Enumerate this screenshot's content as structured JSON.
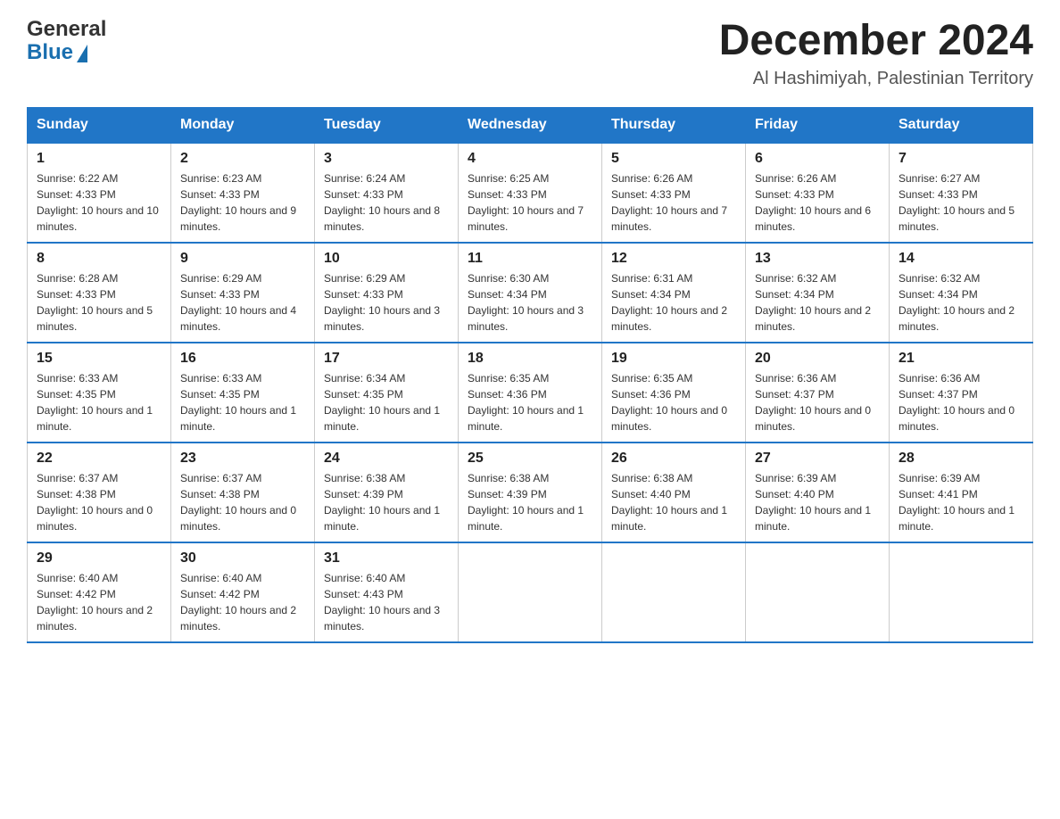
{
  "header": {
    "logo_general": "General",
    "logo_blue": "Blue",
    "month_title": "December 2024",
    "subtitle": "Al Hashimiyah, Palestinian Territory"
  },
  "weekdays": [
    "Sunday",
    "Monday",
    "Tuesday",
    "Wednesday",
    "Thursday",
    "Friday",
    "Saturday"
  ],
  "weeks": [
    [
      {
        "day": "1",
        "sunrise": "6:22 AM",
        "sunset": "4:33 PM",
        "daylight": "10 hours and 10 minutes."
      },
      {
        "day": "2",
        "sunrise": "6:23 AM",
        "sunset": "4:33 PM",
        "daylight": "10 hours and 9 minutes."
      },
      {
        "day": "3",
        "sunrise": "6:24 AM",
        "sunset": "4:33 PM",
        "daylight": "10 hours and 8 minutes."
      },
      {
        "day": "4",
        "sunrise": "6:25 AM",
        "sunset": "4:33 PM",
        "daylight": "10 hours and 7 minutes."
      },
      {
        "day": "5",
        "sunrise": "6:26 AM",
        "sunset": "4:33 PM",
        "daylight": "10 hours and 7 minutes."
      },
      {
        "day": "6",
        "sunrise": "6:26 AM",
        "sunset": "4:33 PM",
        "daylight": "10 hours and 6 minutes."
      },
      {
        "day": "7",
        "sunrise": "6:27 AM",
        "sunset": "4:33 PM",
        "daylight": "10 hours and 5 minutes."
      }
    ],
    [
      {
        "day": "8",
        "sunrise": "6:28 AM",
        "sunset": "4:33 PM",
        "daylight": "10 hours and 5 minutes."
      },
      {
        "day": "9",
        "sunrise": "6:29 AM",
        "sunset": "4:33 PM",
        "daylight": "10 hours and 4 minutes."
      },
      {
        "day": "10",
        "sunrise": "6:29 AM",
        "sunset": "4:33 PM",
        "daylight": "10 hours and 3 minutes."
      },
      {
        "day": "11",
        "sunrise": "6:30 AM",
        "sunset": "4:34 PM",
        "daylight": "10 hours and 3 minutes."
      },
      {
        "day": "12",
        "sunrise": "6:31 AM",
        "sunset": "4:34 PM",
        "daylight": "10 hours and 2 minutes."
      },
      {
        "day": "13",
        "sunrise": "6:32 AM",
        "sunset": "4:34 PM",
        "daylight": "10 hours and 2 minutes."
      },
      {
        "day": "14",
        "sunrise": "6:32 AM",
        "sunset": "4:34 PM",
        "daylight": "10 hours and 2 minutes."
      }
    ],
    [
      {
        "day": "15",
        "sunrise": "6:33 AM",
        "sunset": "4:35 PM",
        "daylight": "10 hours and 1 minute."
      },
      {
        "day": "16",
        "sunrise": "6:33 AM",
        "sunset": "4:35 PM",
        "daylight": "10 hours and 1 minute."
      },
      {
        "day": "17",
        "sunrise": "6:34 AM",
        "sunset": "4:35 PM",
        "daylight": "10 hours and 1 minute."
      },
      {
        "day": "18",
        "sunrise": "6:35 AM",
        "sunset": "4:36 PM",
        "daylight": "10 hours and 1 minute."
      },
      {
        "day": "19",
        "sunrise": "6:35 AM",
        "sunset": "4:36 PM",
        "daylight": "10 hours and 0 minutes."
      },
      {
        "day": "20",
        "sunrise": "6:36 AM",
        "sunset": "4:37 PM",
        "daylight": "10 hours and 0 minutes."
      },
      {
        "day": "21",
        "sunrise": "6:36 AM",
        "sunset": "4:37 PM",
        "daylight": "10 hours and 0 minutes."
      }
    ],
    [
      {
        "day": "22",
        "sunrise": "6:37 AM",
        "sunset": "4:38 PM",
        "daylight": "10 hours and 0 minutes."
      },
      {
        "day": "23",
        "sunrise": "6:37 AM",
        "sunset": "4:38 PM",
        "daylight": "10 hours and 0 minutes."
      },
      {
        "day": "24",
        "sunrise": "6:38 AM",
        "sunset": "4:39 PM",
        "daylight": "10 hours and 1 minute."
      },
      {
        "day": "25",
        "sunrise": "6:38 AM",
        "sunset": "4:39 PM",
        "daylight": "10 hours and 1 minute."
      },
      {
        "day": "26",
        "sunrise": "6:38 AM",
        "sunset": "4:40 PM",
        "daylight": "10 hours and 1 minute."
      },
      {
        "day": "27",
        "sunrise": "6:39 AM",
        "sunset": "4:40 PM",
        "daylight": "10 hours and 1 minute."
      },
      {
        "day": "28",
        "sunrise": "6:39 AM",
        "sunset": "4:41 PM",
        "daylight": "10 hours and 1 minute."
      }
    ],
    [
      {
        "day": "29",
        "sunrise": "6:40 AM",
        "sunset": "4:42 PM",
        "daylight": "10 hours and 2 minutes."
      },
      {
        "day": "30",
        "sunrise": "6:40 AM",
        "sunset": "4:42 PM",
        "daylight": "10 hours and 2 minutes."
      },
      {
        "day": "31",
        "sunrise": "6:40 AM",
        "sunset": "4:43 PM",
        "daylight": "10 hours and 3 minutes."
      },
      null,
      null,
      null,
      null
    ]
  ],
  "labels": {
    "sunrise_prefix": "Sunrise: ",
    "sunset_prefix": "Sunset: ",
    "daylight_prefix": "Daylight: "
  }
}
